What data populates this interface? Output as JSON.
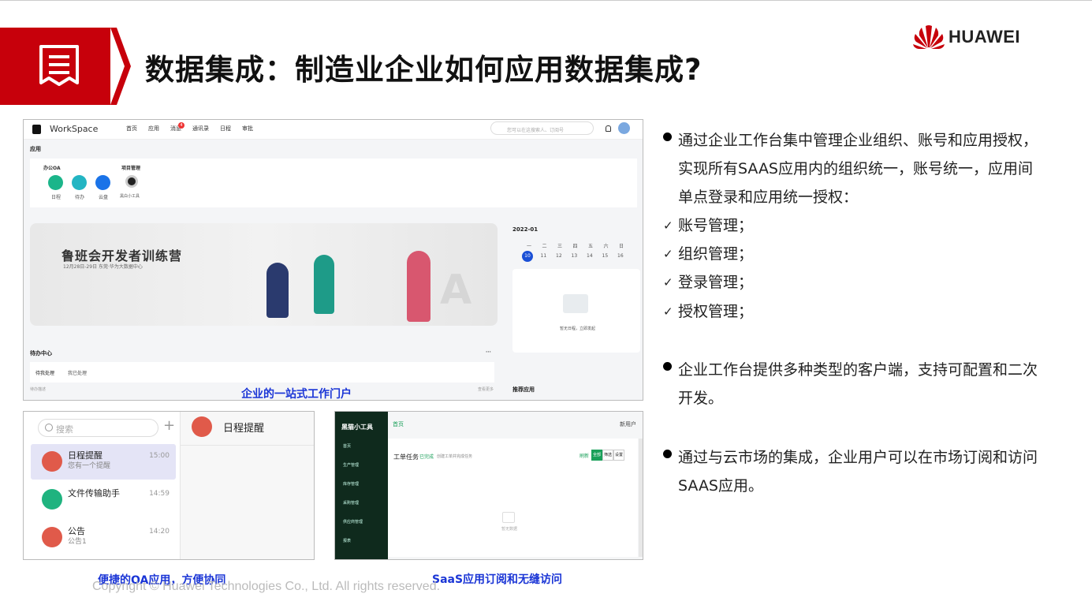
{
  "title": "数据集成：制造业企业如何应用数据集成?",
  "brand": "HUAWEI",
  "workspace": {
    "app_name": "WorkSpace",
    "nav": [
      "首页",
      "应用",
      "消息",
      "通讯录",
      "日程",
      "审批"
    ],
    "nav_badge": "4",
    "search_placeholder": "您可以在这搜索人、订阅号",
    "section_apps": "应用",
    "group_oa": "办公OA",
    "group_pm": "项目管理",
    "apps": [
      "日程",
      "待办",
      "云盘"
    ],
    "pm_app": "黑白小工具",
    "banner_title": "鲁班会开发者训练营",
    "banner_sub": "12月28日-29日 东莞·华为大数据中心",
    "calendar_month": "2022-01",
    "weekdays": [
      "一",
      "二",
      "三",
      "四",
      "五",
      "六",
      "日"
    ],
    "days": [
      "10",
      "11",
      "12",
      "13",
      "14",
      "15",
      "16"
    ],
    "no_schedule": "暂无日程，立即发起",
    "todo_title": "待办中心",
    "todo_tabs": [
      "待我处理",
      "我已处理"
    ],
    "todo_desc": "待办描述",
    "todo_more": "查看更多",
    "recommend": "推荐应用"
  },
  "caption_ws": "企业的一站式工作门户",
  "oa": {
    "search": "搜索",
    "plus": "+",
    "right_title": "日程提醒",
    "items": [
      {
        "name": "日程提醒",
        "sub": "您有一个提醒",
        "time": "15:00"
      },
      {
        "name": "文件传输助手",
        "sub": "",
        "time": "14:59"
      },
      {
        "name": "公告",
        "sub": "公告1",
        "time": "14:20"
      }
    ]
  },
  "caption_oa": "便捷的OA应用，方便协同",
  "saas": {
    "brand": "黑猫小工具",
    "top_link": "首页",
    "new_user": "新用户",
    "task_title": "工单任务",
    "task_tag": "已完成",
    "task_desc": "创建工单并完成任务",
    "refresh": "刷新",
    "actions": [
      "全部",
      "筛选",
      "设置"
    ],
    "empty": "暂无数据",
    "menu": [
      "首页",
      "生产管理",
      "库存管理",
      "采购管理",
      "供应商管理",
      "报表"
    ]
  },
  "caption_saas": "SaaS应用订阅和无缝访问",
  "bullets": {
    "b1_lines": [
      "通过企业工作台集中管理企业组织、账号和应用授权，",
      "实现所有SAAS应用内的组织统一，账号统一，应用间",
      "单点登录和应用统一授权："
    ],
    "checks": [
      "账号管理；",
      "组织管理；",
      "登录管理；",
      "授权管理；"
    ],
    "b2_lines": [
      "企业工作台提供多种类型的客户端，支持可配置和二次",
      "开发。"
    ],
    "b3_lines": [
      "通过与云市场的集成，企业用户可以在市场订阅和访问",
      "SAAS应用。"
    ]
  },
  "copyright": "Copyright © Huawei Technologies Co., Ltd. All rights reserved.",
  "colors": {
    "brand_red": "#c7000b",
    "caption_blue": "#1a35d6"
  }
}
